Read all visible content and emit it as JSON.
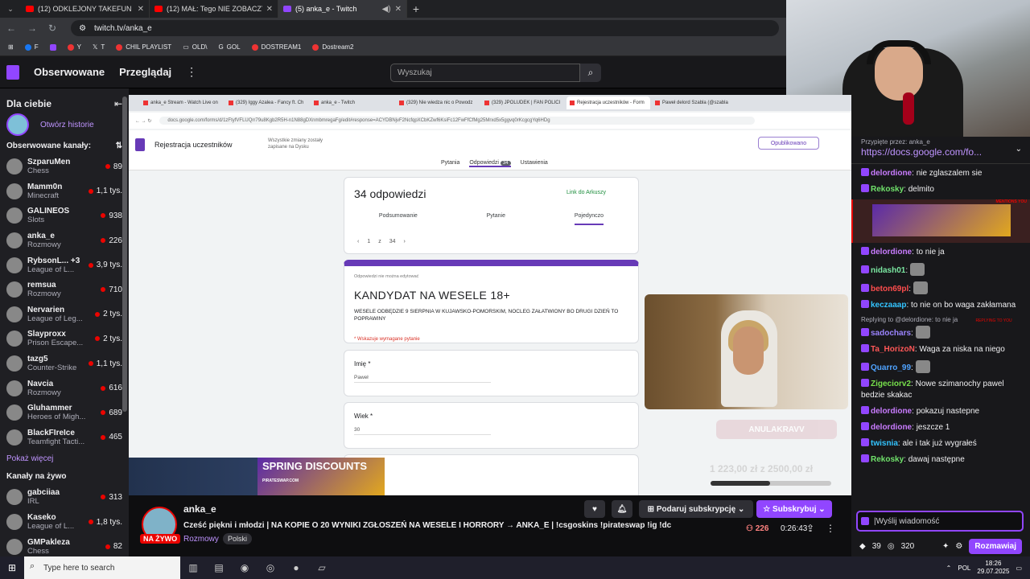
{
  "browser": {
    "tabs": [
      {
        "label": "(12) ODKLEJONY TAKEFUN GA...",
        "active": false,
        "favicon": "youtube-icon"
      },
      {
        "label": "(12) MAŁ: Tego NIE ZOBACZYS...",
        "active": false,
        "favicon": "youtube-icon"
      },
      {
        "label": "(5) anka_e - Twitch",
        "active": true,
        "favicon": "twitch-icon"
      }
    ],
    "url": "twitch.tv/anka_e",
    "bookmarks": [
      "F",
      "",
      "Y",
      "T",
      "CHIL PLAYLIST",
      "OLD\\",
      "GOL",
      "DOSTREAM1",
      "Dostream2"
    ]
  },
  "twitch_nav": {
    "followed": "Obserwowane",
    "browse": "Przeglądaj",
    "search_placeholder": "Wyszukaj"
  },
  "sidebar": {
    "title": "Dla ciebie",
    "stories_label": "Otwórz historie",
    "followed_header": "Obserwowane kanały:",
    "channels": [
      {
        "name": "SzparuMen",
        "game": "Chess",
        "viewers": "89"
      },
      {
        "name": "Mamm0n",
        "game": "Minecraft",
        "viewers": "1,1 tys."
      },
      {
        "name": "GALINEOS",
        "game": "Slots",
        "viewers": "938"
      },
      {
        "name": "anka_e",
        "game": "Rozmowy",
        "viewers": "226"
      },
      {
        "name": "RybsonL... +3",
        "game": "League of L...",
        "viewers": "3,9 tys."
      },
      {
        "name": "remsua",
        "game": "Rozmowy",
        "viewers": "710"
      },
      {
        "name": "Nervarien",
        "game": "League of Leg...",
        "viewers": "2 tys."
      },
      {
        "name": "Slayproxx",
        "game": "Prison Escape...",
        "viewers": "2 tys."
      },
      {
        "name": "tazg5",
        "game": "Counter-Strike",
        "viewers": "1,1 tys."
      },
      {
        "name": "Navcia",
        "game": "Rozmowy",
        "viewers": "616"
      },
      {
        "name": "Gluhammer",
        "game": "Heroes of Migh...",
        "viewers": "689"
      },
      {
        "name": "BlackFIreIce",
        "game": "Teamfight Tacti...",
        "viewers": "465"
      }
    ],
    "show_more": "Pokaż więcej",
    "live_header": "Kanały na żywo",
    "live_channels": [
      {
        "name": "gabciiaa",
        "game": "IRL",
        "viewers": "313"
      },
      {
        "name": "Kaseko",
        "game": "League of L...",
        "viewers": "1,8 tys."
      },
      {
        "name": "GMPakleza",
        "game": "Chess",
        "viewers": "82"
      }
    ]
  },
  "stream_screen": {
    "inner_tabs": [
      "anka_e Stream - Watch Live on",
      "(329) Iggy Azalea - Fancy ft. Ch",
      "anka_e - Twitch",
      "(329) Nie wiedza nic o Powodz",
      "(329) JPOLUDEK | FAN POLICI",
      "Rejestracja uczestników - Form",
      "Paweł delord Szabla (@szabla"
    ],
    "inner_url": "docs.google.com/forms/d/1zFtyfVFLUQrr79u8Kgb2R5H-n1N88gDXnmbmregaFg/edit#response=ACYDBNjvF2NcfqpXCbKZwf6KsiFc12FwFfCfMg25Mrxd5x5ggvq0rKcgcgYq6HDg",
    "form_title": "Rejestracja uczestników",
    "form_save_note": "Wszystkie zmiany zostały zapisane na Dysku",
    "publish": "Opublikowano",
    "form_tabs": [
      "Pytania",
      "Odpowiedzi",
      "Ustawienia"
    ],
    "responses_badge": "34",
    "responses_count": "34 odpowiedzi",
    "sheets_link": "Link do Arkuszy",
    "resp_tabs": [
      "Podsumowanie",
      "Pytanie",
      "Pojedynczo"
    ],
    "pager": {
      "current": "1",
      "of": "z",
      "total": "34"
    },
    "no_edit_note": "Odpowiedzi nie można edytować",
    "form_heading": "KANDYDAT NA WESELE 18+",
    "form_desc": "WESELE ODBĘDZIE 9 SIERPNIA W KUJAWSKO-POMORSKIM, NOCLEG ZAŁATWIONY BO DRUGI DZIEŃ TO POPRAWINY",
    "required_note": "* Wskazuje wymagane pytanie",
    "questions": [
      {
        "label": "Imię *",
        "value": "Paweł"
      },
      {
        "label": "Wiek *",
        "value": "30"
      }
    ],
    "donate_btn": "ANULAKRAVV",
    "goal_label": "1 223,00 zł z 2500,00 zł",
    "goal_progress": 0.49,
    "ad_text": "SPRING DISCOUNTS",
    "ad_sub": "PIRATESWAP.COM"
  },
  "stream_info": {
    "channel": "anka_e",
    "live_badge": "NA ŻYWO",
    "title": "Cześć piękni i młodzi | NA KOPIE O 20 WYNIKI ZGŁOSZEŃ NA WESELE I HORRORY → ANKA_E | !csgoskins !pirateswap !ig !dc",
    "category": "Rozmowy",
    "tag": "Polski",
    "gift_btn": "Podaruj subskrypcję",
    "subscribe_btn": "Subskrybuj",
    "viewers": "226",
    "uptime": "0:26:43"
  },
  "chat": {
    "pinned_by": "Przypięte przez: anka_e",
    "pinned_link": "https://docs.google.com/fo...",
    "messages": [
      {
        "user": "delordione",
        "color": "#c97cff",
        "text": "nie zglaszalem sie"
      },
      {
        "user": "Rekosky",
        "color": "#70e26b",
        "text": "delmito"
      },
      {
        "user": "delordione",
        "color": "#c97cff",
        "text": "to nie ja"
      },
      {
        "user": "nidash01",
        "color": "#7be8a2",
        "text": ""
      },
      {
        "user": "beton69pl",
        "color": "#ff4d4d",
        "text": ""
      },
      {
        "user": "keczaaap",
        "color": "#33c4ff",
        "text": "to nie on bo waga zakłamana"
      },
      {
        "user": "sadochars",
        "color": "#9b84ff",
        "text": ""
      },
      {
        "user": "Ta_HorizoN",
        "color": "#ff5757",
        "text": "Waga za niska na niego"
      },
      {
        "user": "Quarro_99",
        "color": "#4fa3ff",
        "text": ""
      },
      {
        "user": "Zigeciorv2",
        "color": "#77e04b",
        "text": "Nowe szimanochy pawel bedzie skakac"
      },
      {
        "user": "delordione",
        "color": "#c97cff",
        "text": "pokazuj nastepne"
      },
      {
        "user": "delordione",
        "color": "#c97cff",
        "text": "jeszcze 1"
      },
      {
        "user": "twisnia",
        "color": "#33c4ff",
        "text": "ale i tak już wygrałeś"
      },
      {
        "user": "Rekosky",
        "color": "#70e26b",
        "text": "dawaj następne"
      }
    ],
    "reply_note": "Replying to @delordione: to nie ja",
    "mention_tag": "MENTIONS YOU",
    "reply_tag": "REPLYING TO YOU",
    "input_placeholder": "|Wyślij wiadomość",
    "points": "39",
    "channel_points": "320",
    "chat_btn": "Rozmawiaj"
  },
  "taskbar": {
    "search_placeholder": "Type here to search",
    "lang": "POL",
    "time": "18:26",
    "date": "29.07.2025"
  }
}
